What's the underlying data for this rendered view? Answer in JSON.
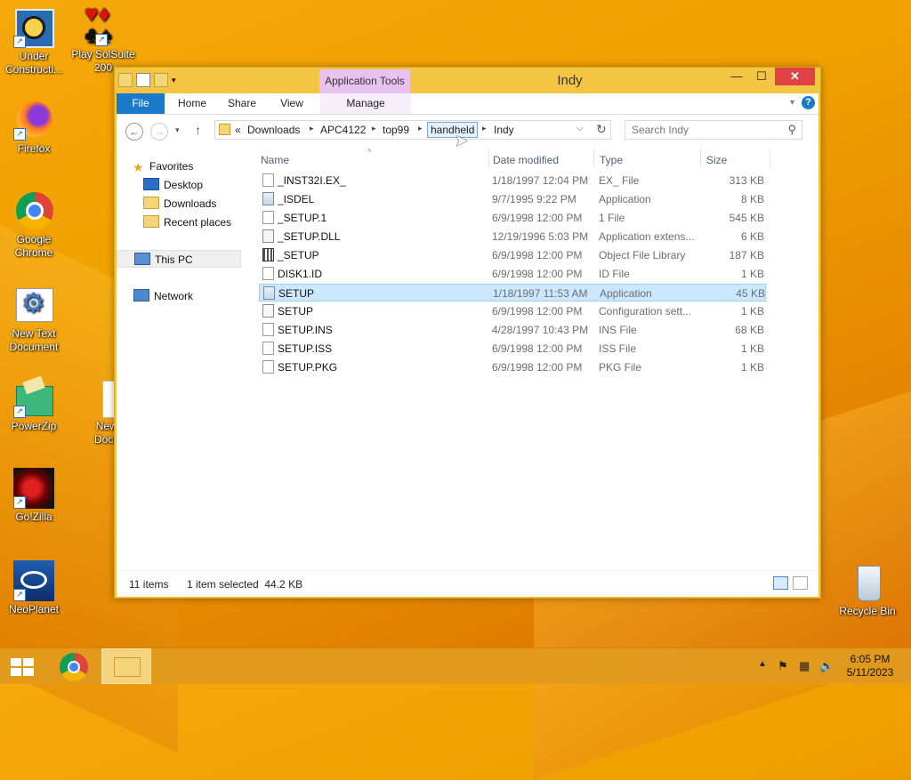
{
  "desktop": {
    "icons": [
      {
        "id": "under-construction",
        "label": "Under Constructi..."
      },
      {
        "id": "play-solsuite",
        "label": "Play SolSuite 200"
      },
      {
        "id": "firefox",
        "label": "Firefox"
      },
      {
        "id": "google-chrome",
        "label": "Google Chrome"
      },
      {
        "id": "new-text-document",
        "label": "New Text Document"
      },
      {
        "id": "new-text-document-2",
        "label": "New T Docum"
      },
      {
        "id": "powerzip",
        "label": "PowerZip"
      },
      {
        "id": "golzilla",
        "label": "Go!Zilla"
      },
      {
        "id": "neoplanet",
        "label": "NeoPlanet"
      },
      {
        "id": "recycle-bin",
        "label": "Recycle Bin"
      }
    ]
  },
  "window": {
    "title": "Indy",
    "context_tab": "Application Tools",
    "ribbon_tabs": [
      "File",
      "Home",
      "Share",
      "View",
      "Manage"
    ],
    "help_label": "?",
    "address": {
      "overflow": "«",
      "crumbs": [
        "Downloads",
        "APC4122",
        "top99",
        "handheld",
        "Indy"
      ],
      "highlighted": "handheld"
    },
    "search_placeholder": "Search Indy",
    "nav_pane": {
      "favorites_label": "Favorites",
      "favorites": [
        "Desktop",
        "Downloads",
        "Recent places"
      ],
      "this_pc": "This PC",
      "network": "Network"
    },
    "columns": {
      "name": "Name",
      "date": "Date modified",
      "type": "Type",
      "size": "Size"
    },
    "files": [
      {
        "name": "_INST32I.EX_",
        "date": "1/18/1997 12:04 PM",
        "type": "EX_ File",
        "size": "313 KB",
        "icon": "file"
      },
      {
        "name": "_ISDEL",
        "date": "9/7/1995 9:22 PM",
        "type": "Application",
        "size": "8 KB",
        "icon": "app"
      },
      {
        "name": "_SETUP.1",
        "date": "6/9/1998 12:00 PM",
        "type": "1 File",
        "size": "545 KB",
        "icon": "file"
      },
      {
        "name": "_SETUP.DLL",
        "date": "12/19/1996 5:03 PM",
        "type": "Application extens...",
        "size": "6 KB",
        "icon": "dll"
      },
      {
        "name": "_SETUP",
        "date": "6/9/1998 12:00 PM",
        "type": "Object File Library",
        "size": "187 KB",
        "icon": "lib"
      },
      {
        "name": "DISK1.ID",
        "date": "6/9/1998 12:00 PM",
        "type": "ID File",
        "size": "1 KB",
        "icon": "file"
      },
      {
        "name": "SETUP",
        "date": "1/18/1997 11:53 AM",
        "type": "Application",
        "size": "45 KB",
        "icon": "app",
        "selected": true
      },
      {
        "name": "SETUP",
        "date": "6/9/1998 12:00 PM",
        "type": "Configuration sett...",
        "size": "1 KB",
        "icon": "cfg"
      },
      {
        "name": "SETUP.INS",
        "date": "4/28/1997 10:43 PM",
        "type": "INS File",
        "size": "68 KB",
        "icon": "file"
      },
      {
        "name": "SETUP.ISS",
        "date": "6/9/1998 12:00 PM",
        "type": "ISS File",
        "size": "1 KB",
        "icon": "file"
      },
      {
        "name": "SETUP.PKG",
        "date": "6/9/1998 12:00 PM",
        "type": "PKG File",
        "size": "1 KB",
        "icon": "file"
      }
    ],
    "status": {
      "count": "11 items",
      "selection": "1 item selected  44.2 KB"
    }
  },
  "taskbar": {
    "items": [
      "start-button",
      "chrome",
      "file-explorer"
    ],
    "active": "file-explorer",
    "time": "6:05 PM",
    "date": "5/11/2023"
  },
  "colors": {
    "wallpaper": "#f0a000",
    "window_frame": "#f4c542",
    "file_tab": "#1979ca",
    "selection": "#cce8ff",
    "close_button": "#e04343"
  }
}
